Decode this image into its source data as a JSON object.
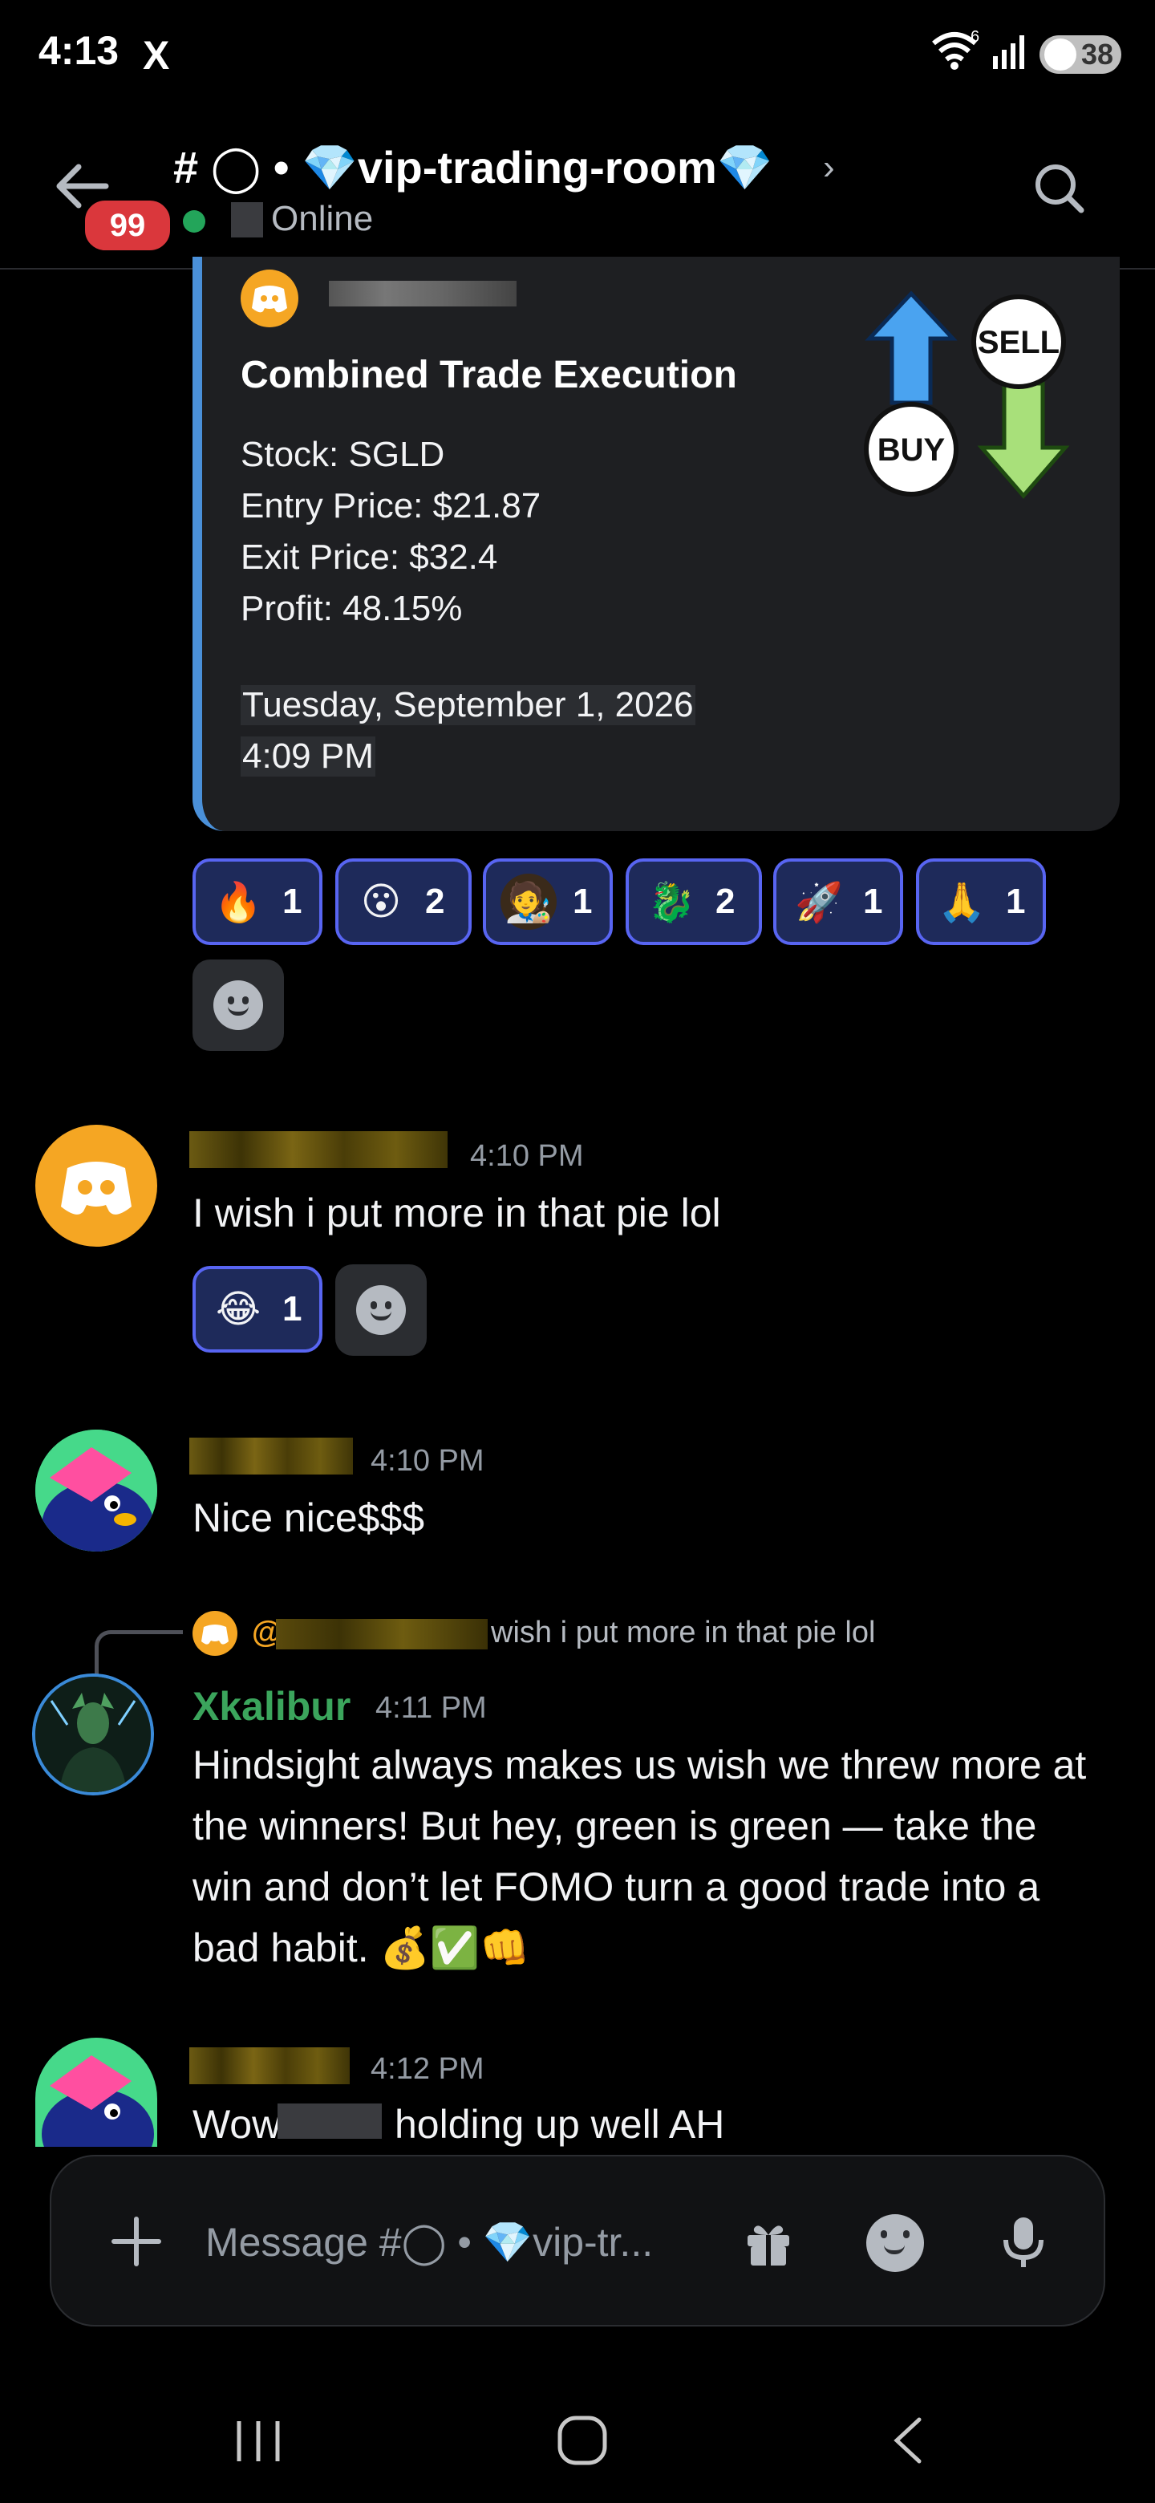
{
  "status_bar": {
    "time": "4:13",
    "notification_icon": "X",
    "wifi_label": "6",
    "battery": "38"
  },
  "header": {
    "unread_badge": "99",
    "channel_name": "# ◯ • 💎vip-trading-room💎",
    "chevron": "›",
    "status": "Online"
  },
  "embed": {
    "title": "Combined Trade Execution",
    "lines": [
      "Stock: SGLD",
      "Entry Price: $21.87",
      "Exit Price: $32.4",
      "Profit: 48.15%"
    ],
    "date": "Tuesday, September 1, 2026",
    "time": "4:09 PM",
    "thumbnail": {
      "buy": "BUY",
      "sell": "SELL"
    }
  },
  "embed_reactions": [
    {
      "emoji": "🔥",
      "count": "1"
    },
    {
      "emoji": "😮",
      "count": "2"
    },
    {
      "emoji": "🧑‍🎨",
      "count": "1"
    },
    {
      "emoji": "🐉",
      "count": "2"
    },
    {
      "emoji": "🚀",
      "count": "1"
    },
    {
      "emoji": "🙏",
      "count": "1"
    }
  ],
  "messages": [
    {
      "time": "4:10 PM",
      "text": "I wish i put more in that pie lol",
      "reaction": {
        "emoji": "😂",
        "count": "1"
      }
    },
    {
      "time": "4:10 PM",
      "text": "Nice nice$$$"
    },
    {
      "reply": {
        "at": "@",
        "text": "wish i put more in that pie lol"
      },
      "author": "Xkalibur",
      "time": "4:11 PM",
      "lines": [
        "Hindsight always makes us wish we threw more at",
        "the winners! But hey, green is green — take the",
        "win and don’t let FOMO turn a good trade into a",
        "bad habit. 💰✅👊"
      ]
    },
    {
      "time": "4:12 PM",
      "text_start": "Wow",
      "text_end": "holding up well AH"
    }
  ],
  "input": {
    "placeholder": "Message #◯ • 💎vip-tr..."
  }
}
